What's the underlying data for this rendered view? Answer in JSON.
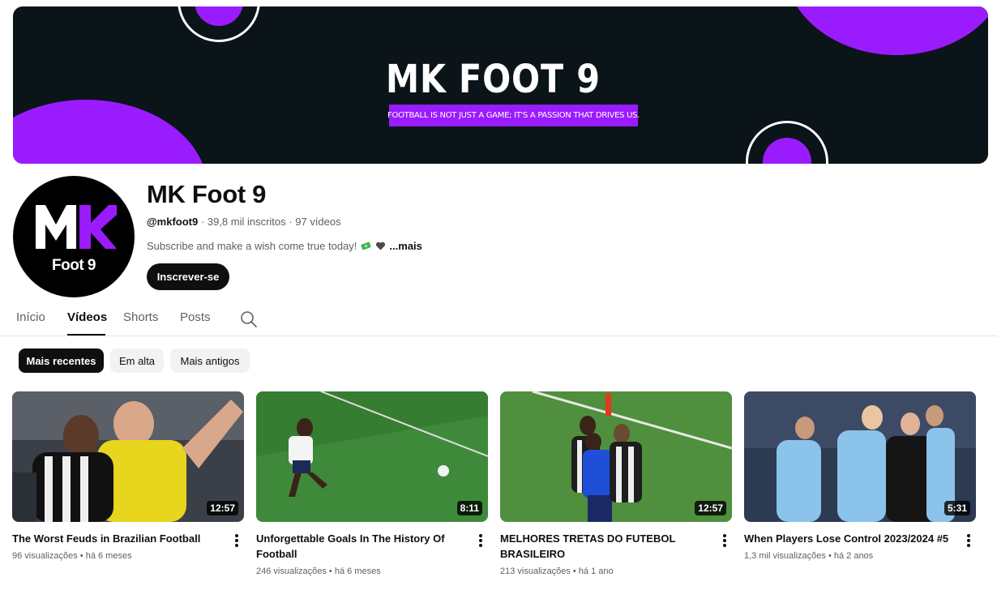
{
  "banner": {
    "title": "MK FOOT 9",
    "tagline": "FOOTBALL IS NOT JUST A GAME; IT'S A PASSION THAT DRIVES US."
  },
  "avatar": {
    "letters": "MK",
    "subtitle": "Foot 9"
  },
  "channel": {
    "name": "MK Foot 9",
    "handle": "@mkfoot9",
    "subscribers": "39,8 mil inscritos",
    "videos_count": "97 vídeos",
    "separator": "·",
    "description": "Subscribe and make a wish come true today!",
    "more_label": "...mais",
    "subscribe_label": "Inscrever-se"
  },
  "tabs": {
    "home": "Início",
    "videos": "Vídeos",
    "shorts": "Shorts",
    "posts": "Posts"
  },
  "chips": {
    "recent": "Mais recentes",
    "popular": "Em alta",
    "oldest": "Mais antigos"
  },
  "videos": [
    {
      "title": "The Worst Feuds in Brazilian Football",
      "views": "96 visualizações",
      "age": "há 6 meses",
      "duration": "12:57"
    },
    {
      "title": "Unforgettable Goals In The History Of Football",
      "views": "246 visualizações",
      "age": "há 6 meses",
      "duration": "8:11"
    },
    {
      "title": "MELHORES TRETAS DO FUTEBOL BRASILEIRO",
      "views": "213 visualizações",
      "age": "há 1 ano",
      "duration": "12:57"
    },
    {
      "title": "When Players Lose Control 2023/2024 #5",
      "views": "1,3 mil visualizações",
      "age": "há 2 anos",
      "duration": "5:31"
    }
  ],
  "video_meta_separator": "•",
  "colors": {
    "accent": "#9b1bff",
    "banner_bg": "#0b1418",
    "text": "#0f0f0f",
    "muted": "#606060",
    "chip_bg": "#f2f2f2"
  },
  "icons": [
    "search-icon",
    "more-vert-icon",
    "money-emoji-icon",
    "heart-emoji-icon"
  ]
}
